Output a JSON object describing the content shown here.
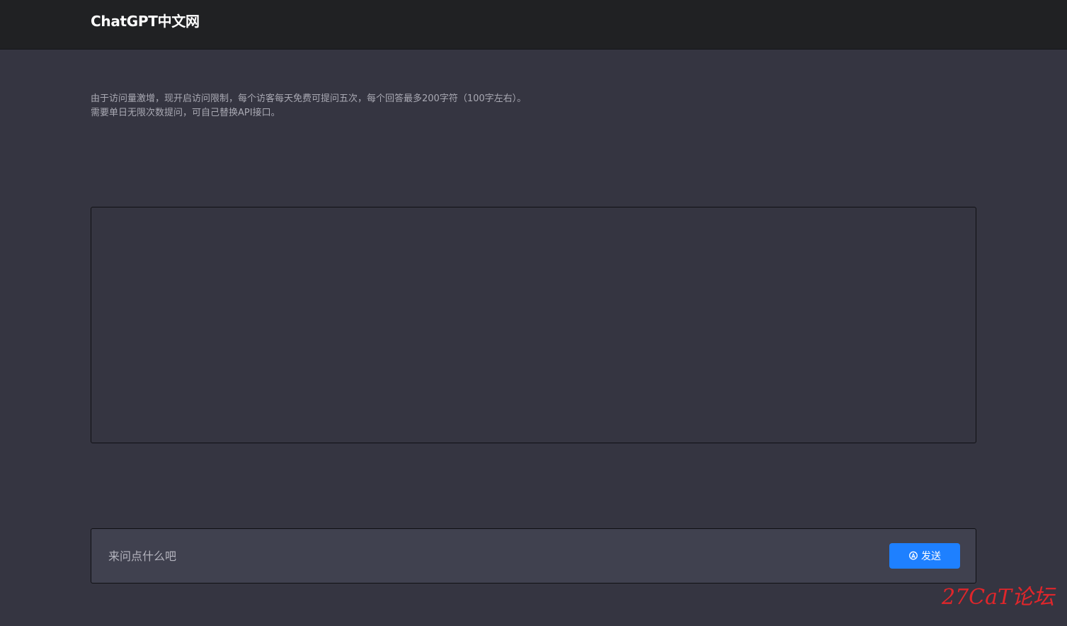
{
  "header": {
    "brand": "ChatGPT中文网"
  },
  "notice": {
    "line1": "由于访问量激增，现开启访问限制，每个访客每天免费可提问五次，每个回答最多200字符（100字左右）。",
    "line2": "需要单日无限次数提问，可自己替换API接口。"
  },
  "composer": {
    "placeholder": "来问点什么吧",
    "value": "",
    "send_label": "发送",
    "send_icon": "send-icon"
  },
  "watermark": {
    "text": "27CaT论坛"
  },
  "colors": {
    "header_bg": "#202123",
    "page_bg": "#353541",
    "input_bg": "#40414f",
    "accent": "#1e80ff",
    "watermark": "#e0262b"
  }
}
